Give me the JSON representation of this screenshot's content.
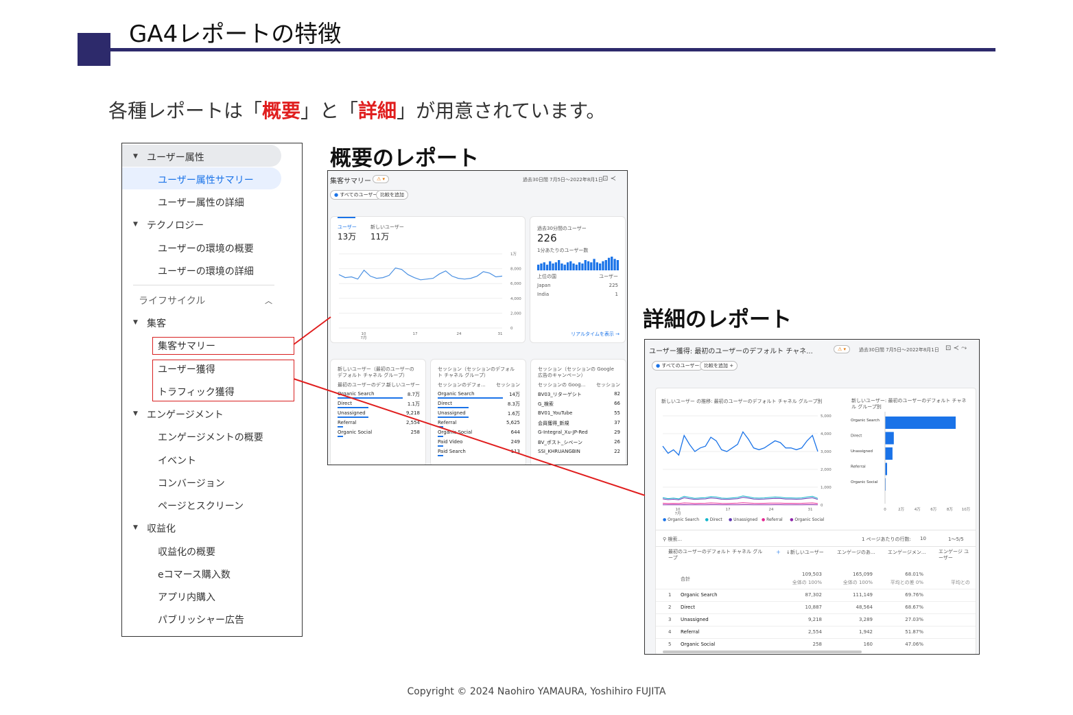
{
  "slide": {
    "title": "GA4レポートの特徴",
    "subtitle_pre": "各種レポートは「",
    "subtitle_kw1": "概要",
    "subtitle_mid": "」と「",
    "subtitle_kw2": "詳細",
    "subtitle_post": "」が用意されています。",
    "overview_heading": "概要のレポート",
    "detail_heading": "詳細のレポート",
    "copyright": "Copyright © 2024 Naohiro YAMAURA, Yoshihiro FUJITA"
  },
  "sidebar": {
    "items": [
      {
        "label": "ユーザー属性"
      },
      {
        "label": "ユーザー属性サマリー"
      },
      {
        "label": "ユーザー属性の詳細"
      },
      {
        "label": "テクノロジー"
      },
      {
        "label": "ユーザーの環境の概要"
      },
      {
        "label": "ユーザーの環境の詳細"
      },
      {
        "label": "ライフサイクル"
      },
      {
        "label": "集客"
      },
      {
        "label": "集客サマリー"
      },
      {
        "label": "ユーザー獲得"
      },
      {
        "label": "トラフィック獲得"
      },
      {
        "label": "エンゲージメント"
      },
      {
        "label": "エンゲージメントの概要"
      },
      {
        "label": "イベント"
      },
      {
        "label": "コンバージョン"
      },
      {
        "label": "ページとスクリーン"
      },
      {
        "label": "収益化"
      },
      {
        "label": "収益化の概要"
      },
      {
        "label": "eコマース購入数"
      },
      {
        "label": "アプリ内購入"
      },
      {
        "label": "パブリッシャー広告"
      }
    ]
  },
  "overview": {
    "title": "集客サマリー",
    "date_range": "過去30日間 7月5日～2022年8月1日",
    "chip_all_users": "すべてのユーザー",
    "chip_compare": "比較を追加",
    "metric1_label": "ユーザー",
    "metric1_value": "13万",
    "metric2_label": "新しいユーザー",
    "metric2_value": "11万",
    "realtime_label": "過去30分間のユーザー",
    "realtime_value": "226",
    "realtime_sub": "1分あたりのユーザー数",
    "realtime_col1": "上位の国",
    "realtime_col2": "ユーザー",
    "realtime_rows": [
      {
        "country": "Japan",
        "users": "225"
      },
      {
        "country": "India",
        "users": "1"
      }
    ],
    "realtime_link": "リアルタイムを表示 →",
    "yticks": [
      "1万",
      "8,000",
      "6,000",
      "4,000",
      "2,000",
      "0"
    ],
    "xticks": [
      "10\n7月",
      "17",
      "24",
      "31"
    ],
    "line_values": [
      7200,
      6800,
      6900,
      6600,
      7800,
      7000,
      6700,
      6800,
      7100,
      8100,
      7900,
      7200,
      6800,
      6500,
      6600,
      6700,
      7300,
      7700,
      7000,
      6700,
      6600,
      6700,
      7000,
      7600,
      7400,
      6900,
      7000
    ],
    "bar_values": [
      5,
      6,
      7,
      5,
      8,
      6,
      7,
      9,
      6,
      5,
      7,
      8,
      6,
      5,
      7,
      6,
      9,
      8,
      7,
      10,
      7,
      6,
      8,
      9,
      11,
      12,
      10,
      9
    ],
    "card1_title": "新しいユーザー（最初のユーザーのデフォルト チャネル グループ）",
    "card1_col1": "最初のユーザーのデフ...",
    "card1_col2": "新しいユーザー",
    "card1_rows": [
      {
        "name": "Organic Search",
        "value": "8.7万"
      },
      {
        "name": "Direct",
        "value": "1.1万"
      },
      {
        "name": "Unassigned",
        "value": "9,218"
      },
      {
        "name": "Referral",
        "value": "2,554"
      },
      {
        "name": "Organic Social",
        "value": "258"
      }
    ],
    "card2_title": "セッション（セッションのデフォルト チャネル グループ）",
    "card2_col1": "セッションのデフォ...",
    "card2_col2": "セッション",
    "card2_rows": [
      {
        "name": "Organic Search",
        "value": "14万"
      },
      {
        "name": "Direct",
        "value": "8.3万"
      },
      {
        "name": "Unassigned",
        "value": "1.6万"
      },
      {
        "name": "Referral",
        "value": "5,625"
      },
      {
        "name": "Organic Social",
        "value": "644"
      },
      {
        "name": "Paid Video",
        "value": "249"
      },
      {
        "name": "Paid Search",
        "value": "113"
      }
    ],
    "card3_title": "セッション（セッションの Google 広告のキャンペーン）",
    "card3_col1": "セッションの Goog...",
    "card3_col2": "セッション",
    "card3_rows": [
      {
        "name": "BV03_リターゲシト",
        "value": "82"
      },
      {
        "name": "G_検索",
        "value": "66"
      },
      {
        "name": "BV01_YouTube",
        "value": "55"
      },
      {
        "name": "会員獲得_新規",
        "value": "37"
      },
      {
        "name": "G-Integral_Xu-JP-Red",
        "value": "29"
      },
      {
        "name": "BV_ポスト_シベーン",
        "value": "26"
      },
      {
        "name": "SSI_KHRUANGBIN",
        "value": "22"
      }
    ]
  },
  "detail": {
    "title": "ユーザー獲得: 最初のユーザーのデフォルト チャネ...",
    "date_range": "過去30日間 7月5日～2022年8月1日",
    "chip_all_users": "すべてのユーザー",
    "chip_compare": "比較を追加 +",
    "line_chart_title": "新しいユーザー の推移: 最初のユーザーのデフォルト チャネル グループ別",
    "bar_chart_title": "新しいユーザー: 最初のユーザーのデフォルト チャネル グループ別",
    "yticks": [
      "5,000",
      "4,000",
      "3,000",
      "2,000",
      "1,000",
      "0"
    ],
    "xticks": [
      "10\n7月",
      "17",
      "24",
      "31"
    ],
    "legend": [
      {
        "name": "Organic Search",
        "color": "#1a73e8"
      },
      {
        "name": "Direct",
        "color": "#12b5cb"
      },
      {
        "name": "Unassigned",
        "color": "#5e35b1"
      },
      {
        "name": "Referral",
        "color": "#e52592"
      },
      {
        "name": "Organic Social",
        "color": "#8e24aa"
      }
    ],
    "organic_line": [
      3300,
      2900,
      3100,
      2800,
      3900,
      3400,
      3000,
      3200,
      3300,
      3800,
      3600,
      3100,
      3000,
      3200,
      3400,
      4100,
      3700,
      3200,
      3100,
      3200,
      3400,
      3600,
      3500,
      3200,
      3200,
      3100,
      3200,
      3600,
      3900,
      3000
    ],
    "bar_categories": [
      "Organic Search",
      "Direct",
      "Unassigned",
      "Referral",
      "Organic Social"
    ],
    "bar_values": [
      87302,
      10887,
      9218,
      2554,
      258
    ],
    "bar_xticks": [
      "0",
      "2万",
      "4万",
      "6万",
      "8万",
      "10万"
    ],
    "search_placeholder": "検索...",
    "rows_per_page_label": "1 ページあたりの行数:",
    "rows_per_page": "10",
    "pagination": "1～5/5",
    "col_dimension": "最初のユーザーのデフォルト チャネル グループ",
    "col_new_users": "↓新しいユーザー",
    "col_engaged": "エンゲージのあ...",
    "col_rate": "エンゲージメン...",
    "col_more": "エンゲージ ユーザー",
    "total_label": "合計",
    "total_new_users": "109,503",
    "total_new_users_sub": "全体の 100%",
    "total_engaged": "165,099",
    "total_engaged_sub": "全体の 100%",
    "total_rate": "68.01%",
    "total_rate_sub": "平均との差 0%",
    "total_more_sub": "平均との",
    "rows": [
      {
        "rank": "1",
        "name": "Organic Search",
        "new_users": "87,302",
        "engaged": "111,149",
        "rate": "69.76%"
      },
      {
        "rank": "2",
        "name": "Direct",
        "new_users": "10,887",
        "engaged": "48,564",
        "rate": "68.67%"
      },
      {
        "rank": "3",
        "name": "Unassigned",
        "new_users": "9,218",
        "engaged": "3,289",
        "rate": "27.03%"
      },
      {
        "rank": "4",
        "name": "Referral",
        "new_users": "2,554",
        "engaged": "1,942",
        "rate": "51.87%"
      },
      {
        "rank": "5",
        "name": "Organic Social",
        "new_users": "258",
        "engaged": "160",
        "rate": "47.06%"
      }
    ]
  }
}
